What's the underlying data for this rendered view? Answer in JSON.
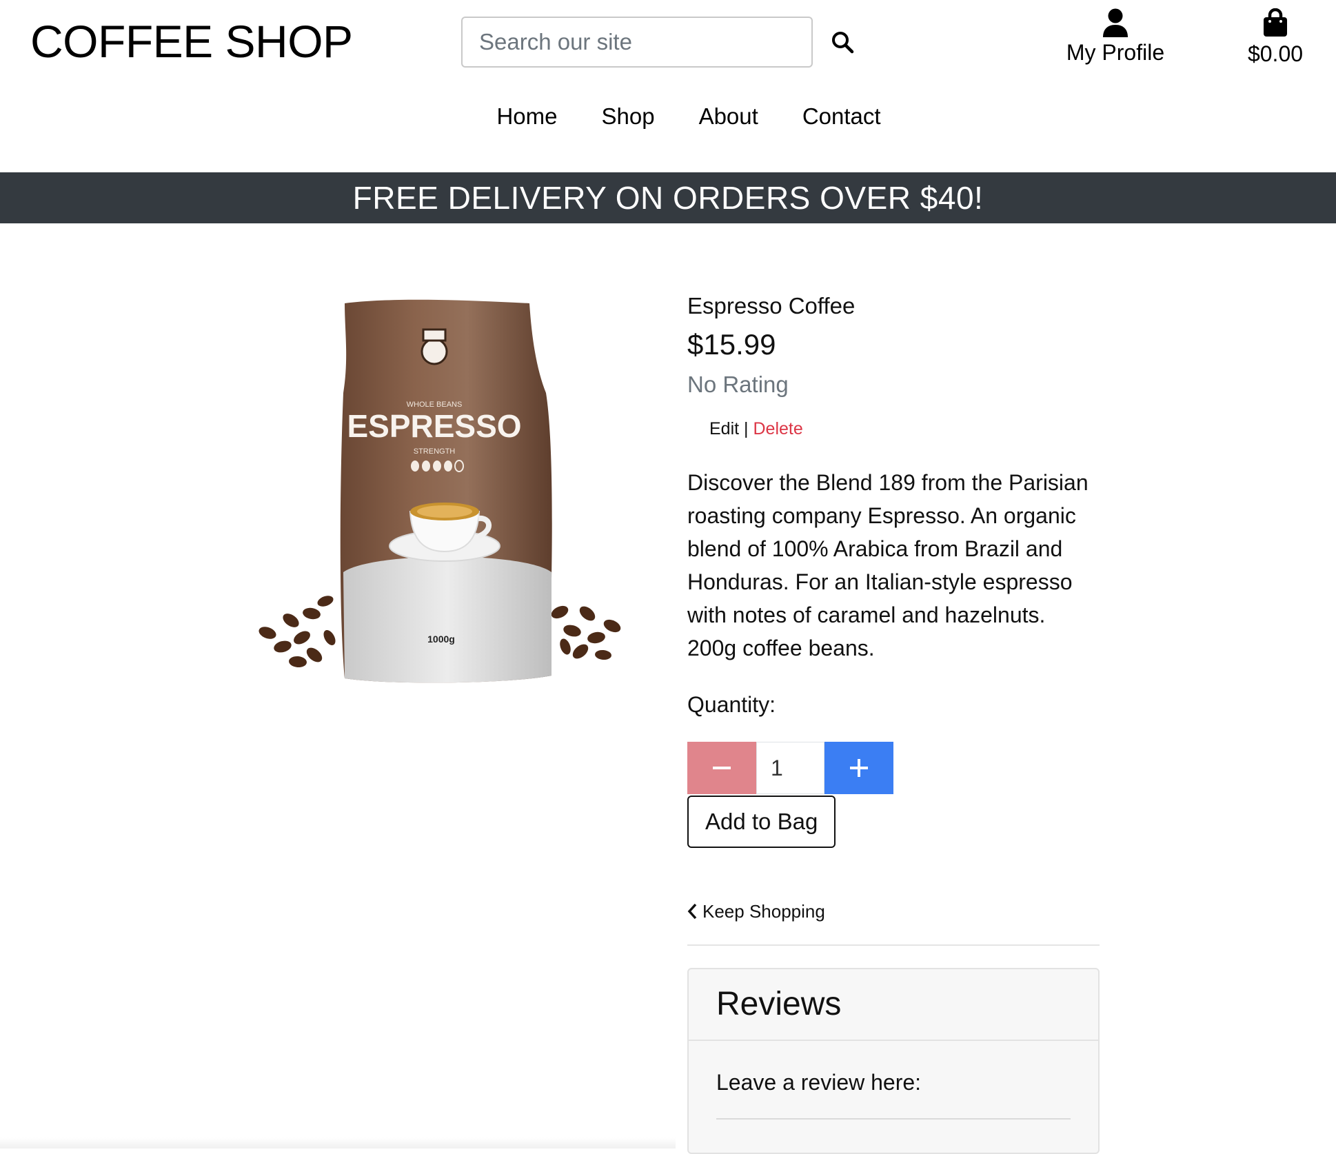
{
  "header": {
    "logo": "COFFEE SHOP",
    "search_placeholder": "Search our site",
    "profile_label": "My Profile",
    "bag_total": "$0.00"
  },
  "nav": {
    "items": [
      "Home",
      "Shop",
      "About",
      "Contact"
    ]
  },
  "banner": "FREE DELIVERY ON ORDERS OVER $40!",
  "product": {
    "image_label": "WHOLE BEANS",
    "image_title": "ESPRESSO",
    "image_strength": "STRENGTH",
    "image_weight": "1000g",
    "name": "Espresso Coffee",
    "price": "$15.99",
    "rating": "No Rating",
    "edit_label": "Edit",
    "admin_separator": " | ",
    "delete_label": "Delete",
    "description": "Discover the Blend 189 from the Parisian roasting company Espresso. An organic blend of 100% Arabica from Brazil and Honduras. For an Italian-style espresso with notes of caramel and hazelnuts. 200g coffee beans.",
    "quantity_label": "Quantity:",
    "quantity_value": "1",
    "add_to_bag_label": "Add to Bag",
    "keep_shopping_label": "Keep Shopping"
  },
  "reviews": {
    "title": "Reviews",
    "prompt": "Leave a review here:"
  },
  "colors": {
    "banner_bg": "#343a40",
    "minus_button": "#e0858c",
    "plus_button": "#3b7ef3",
    "delete_link": "#dc3545",
    "muted_text": "#6c757d"
  },
  "icons": {
    "search": "search-icon",
    "profile": "user-icon",
    "bag": "shopping-bag-icon",
    "minus": "minus-icon",
    "plus": "plus-icon",
    "back": "chevron-left-icon"
  }
}
